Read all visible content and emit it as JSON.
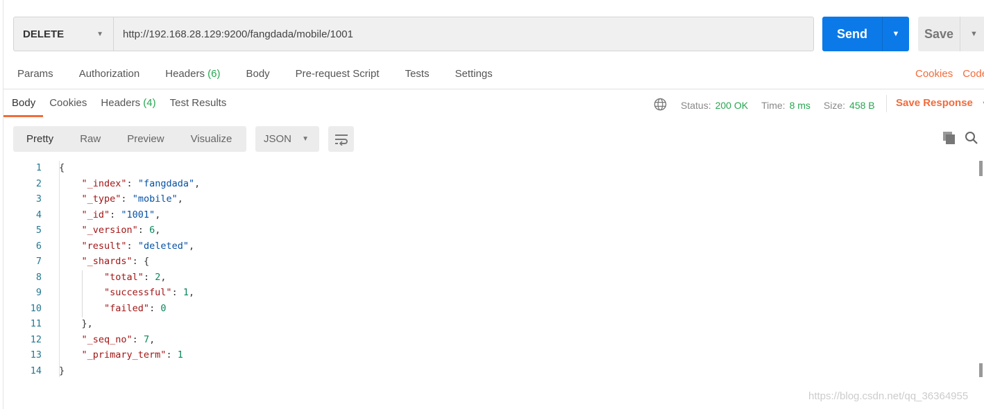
{
  "request": {
    "method": "DELETE",
    "url": "http://192.168.28.129:9200/fangdada/mobile/1001",
    "send_label": "Send",
    "save_label": "Save"
  },
  "request_tabs": [
    {
      "label": "Params"
    },
    {
      "label": "Authorization"
    },
    {
      "label": "Headers",
      "count": "(6)"
    },
    {
      "label": "Body"
    },
    {
      "label": "Pre-request Script"
    },
    {
      "label": "Tests"
    },
    {
      "label": "Settings"
    }
  ],
  "request_links": {
    "cookies": "Cookies",
    "code": "Code"
  },
  "response_tabs": [
    {
      "label": "Body",
      "active": true
    },
    {
      "label": "Cookies"
    },
    {
      "label": "Headers",
      "count": "(4)"
    },
    {
      "label": "Test Results"
    }
  ],
  "response_status": {
    "status_label": "Status:",
    "status": "200 OK",
    "time_label": "Time:",
    "time": "8 ms",
    "size_label": "Size:",
    "size": "458 B",
    "save_response": "Save Response"
  },
  "view_modes": [
    "Pretty",
    "Raw",
    "Preview",
    "Visualize"
  ],
  "format": "JSON",
  "colors": {
    "accent": "#f26b3a",
    "send": "#0b7ae8",
    "success": "#26a650"
  },
  "body_lines": [
    {
      "n": "1",
      "indent": 0,
      "key": "",
      "value": "{",
      "vt": "p",
      "tail": ""
    },
    {
      "n": "2",
      "indent": 1,
      "key": "\"_index\"",
      "value": "\"fangdada\"",
      "vt": "s",
      "tail": ","
    },
    {
      "n": "3",
      "indent": 1,
      "key": "\"_type\"",
      "value": "\"mobile\"",
      "vt": "s",
      "tail": ","
    },
    {
      "n": "4",
      "indent": 1,
      "key": "\"_id\"",
      "value": "\"1001\"",
      "vt": "s",
      "tail": ","
    },
    {
      "n": "5",
      "indent": 1,
      "key": "\"_version\"",
      "value": "6",
      "vt": "n",
      "tail": ","
    },
    {
      "n": "6",
      "indent": 1,
      "key": "\"result\"",
      "value": "\"deleted\"",
      "vt": "s",
      "tail": ","
    },
    {
      "n": "7",
      "indent": 1,
      "key": "\"_shards\"",
      "value": "{",
      "vt": "p",
      "tail": ""
    },
    {
      "n": "8",
      "indent": 2,
      "key": "\"total\"",
      "value": "2",
      "vt": "n",
      "tail": ","
    },
    {
      "n": "9",
      "indent": 2,
      "key": "\"successful\"",
      "value": "1",
      "vt": "n",
      "tail": ","
    },
    {
      "n": "10",
      "indent": 2,
      "key": "\"failed\"",
      "value": "0",
      "vt": "n",
      "tail": ""
    },
    {
      "n": "11",
      "indent": 1,
      "key": "",
      "value": "}",
      "vt": "p",
      "tail": ","
    },
    {
      "n": "12",
      "indent": 1,
      "key": "\"_seq_no\"",
      "value": "7",
      "vt": "n",
      "tail": ","
    },
    {
      "n": "13",
      "indent": 1,
      "key": "\"_primary_term\"",
      "value": "1",
      "vt": "n",
      "tail": ""
    },
    {
      "n": "14",
      "indent": 0,
      "key": "",
      "value": "}",
      "vt": "p",
      "tail": ""
    }
  ],
  "watermark": "https://blog.csdn.net/qq_36364955"
}
